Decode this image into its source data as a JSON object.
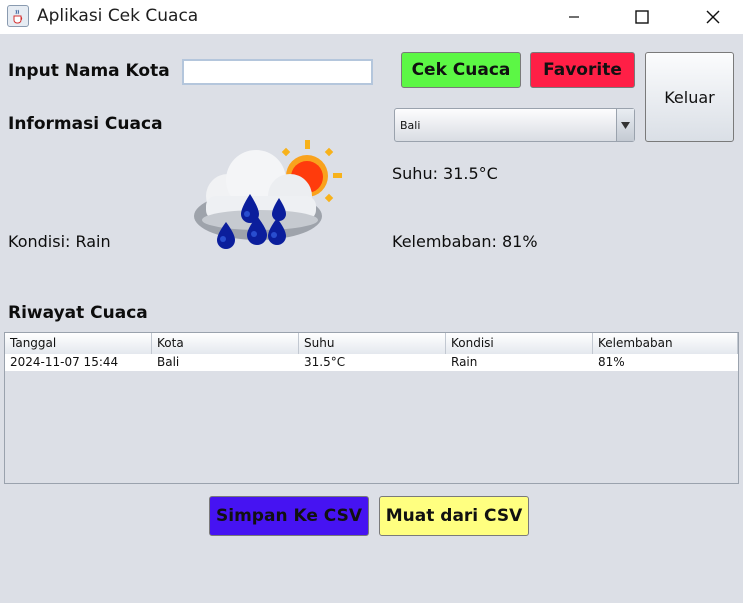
{
  "window": {
    "title": "Aplikasi Cek Cuaca",
    "icon": "java-cup-icon"
  },
  "form": {
    "city_label": "Input Nama Kota",
    "city_value": "",
    "info_label": "Informasi Cuaca"
  },
  "buttons": {
    "check": "Cek Cuaca",
    "favorite": "Favorite",
    "exit": "Keluar",
    "save_csv": "Simpan Ke CSV",
    "load_csv": "Muat dari CSV"
  },
  "favorites": {
    "selected": "Bali"
  },
  "weather": {
    "temperature": "Suhu: 31.5°C",
    "condition": "Kondisi: Rain",
    "humidity": "Kelembaban: 81%",
    "icon": "rain-cloud-sun-icon"
  },
  "history": {
    "title": "Riwayat Cuaca",
    "columns": [
      "Tanggal",
      "Kota",
      "Suhu",
      "Kondisi",
      "Kelembaban"
    ],
    "rows": [
      [
        "2024-11-07 15:44",
        "Bali",
        "31.5°C",
        "Rain",
        "81%"
      ]
    ]
  },
  "colors": {
    "check_button": "#5cf745",
    "favorite_button": "#ff1f46",
    "save_button": "#4613f2",
    "load_button": "#ffff80",
    "background": "#dcdfe6"
  }
}
